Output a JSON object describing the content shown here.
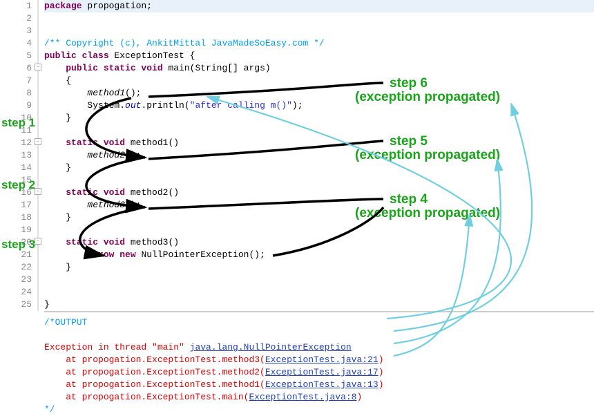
{
  "gutter_lines": [
    "1",
    "2",
    "3",
    "4",
    "5",
    "6",
    "7",
    "8",
    "9",
    "10",
    "11",
    "12",
    "13",
    "14",
    "15",
    "16",
    "17",
    "18",
    "19",
    "20",
    "21",
    "22",
    "23",
    "24",
    "25"
  ],
  "foldable_lines": [
    6,
    12,
    16,
    20
  ],
  "code": {
    "l1": {
      "kw": "package",
      "rest": " propogation;"
    },
    "l4": "/** Copyright (c), AnkitMittal JavaMadeSoEasy.com */",
    "l5": {
      "a": "public class",
      "b": " ExceptionTest {"
    },
    "l6": {
      "a": "public static void",
      "b": " main(String[] args)"
    },
    "l7": "{",
    "l8": {
      "call": "method1",
      "after": "();"
    },
    "l9": {
      "a": "System.",
      "b": "out",
      "c": ".println(",
      "str": "\"after calling m()\"",
      "d": ");"
    },
    "l10": "}",
    "l12": {
      "a": "static void",
      "b": " method1()"
    },
    "l13": {
      "call": "method2",
      "after": "();"
    },
    "l14": "}",
    "l16": {
      "a": "static void",
      "b": " method2()"
    },
    "l17": {
      "call": "method3",
      "after": "();"
    },
    "l18": "}",
    "l20": {
      "a": "static void",
      "b": " method3()"
    },
    "l21": {
      "a": "throw new",
      "b": " NullPointerException();"
    },
    "l22": "}",
    "l25": "}"
  },
  "output": {
    "block_start": "/*OUTPUT",
    "err_prefix": "Exception in thread \"main\" ",
    "err_class": "java.lang.NullPointerException",
    "frames": [
      {
        "pre": "    at propogation.ExceptionTest.method3(",
        "link": "ExceptionTest.java:21",
        "post": ")"
      },
      {
        "pre": "    at propogation.ExceptionTest.method2(",
        "link": "ExceptionTest.java:17",
        "post": ")"
      },
      {
        "pre": "    at propogation.ExceptionTest.method1(",
        "link": "ExceptionTest.java:13",
        "post": ")"
      },
      {
        "pre": "    at propogation.ExceptionTest.main(",
        "link": "ExceptionTest.java:8",
        "post": ")"
      }
    ],
    "block_end": "*/"
  },
  "steps": {
    "s1": "step 1",
    "s2": "step 2",
    "s3": "step 3",
    "s4a": "step 4",
    "s4b": "(exception propagated)",
    "s5a": "step 5",
    "s5b": "(exception propagated)",
    "s6a": "step 6",
    "s6b": "(exception propagated)"
  }
}
